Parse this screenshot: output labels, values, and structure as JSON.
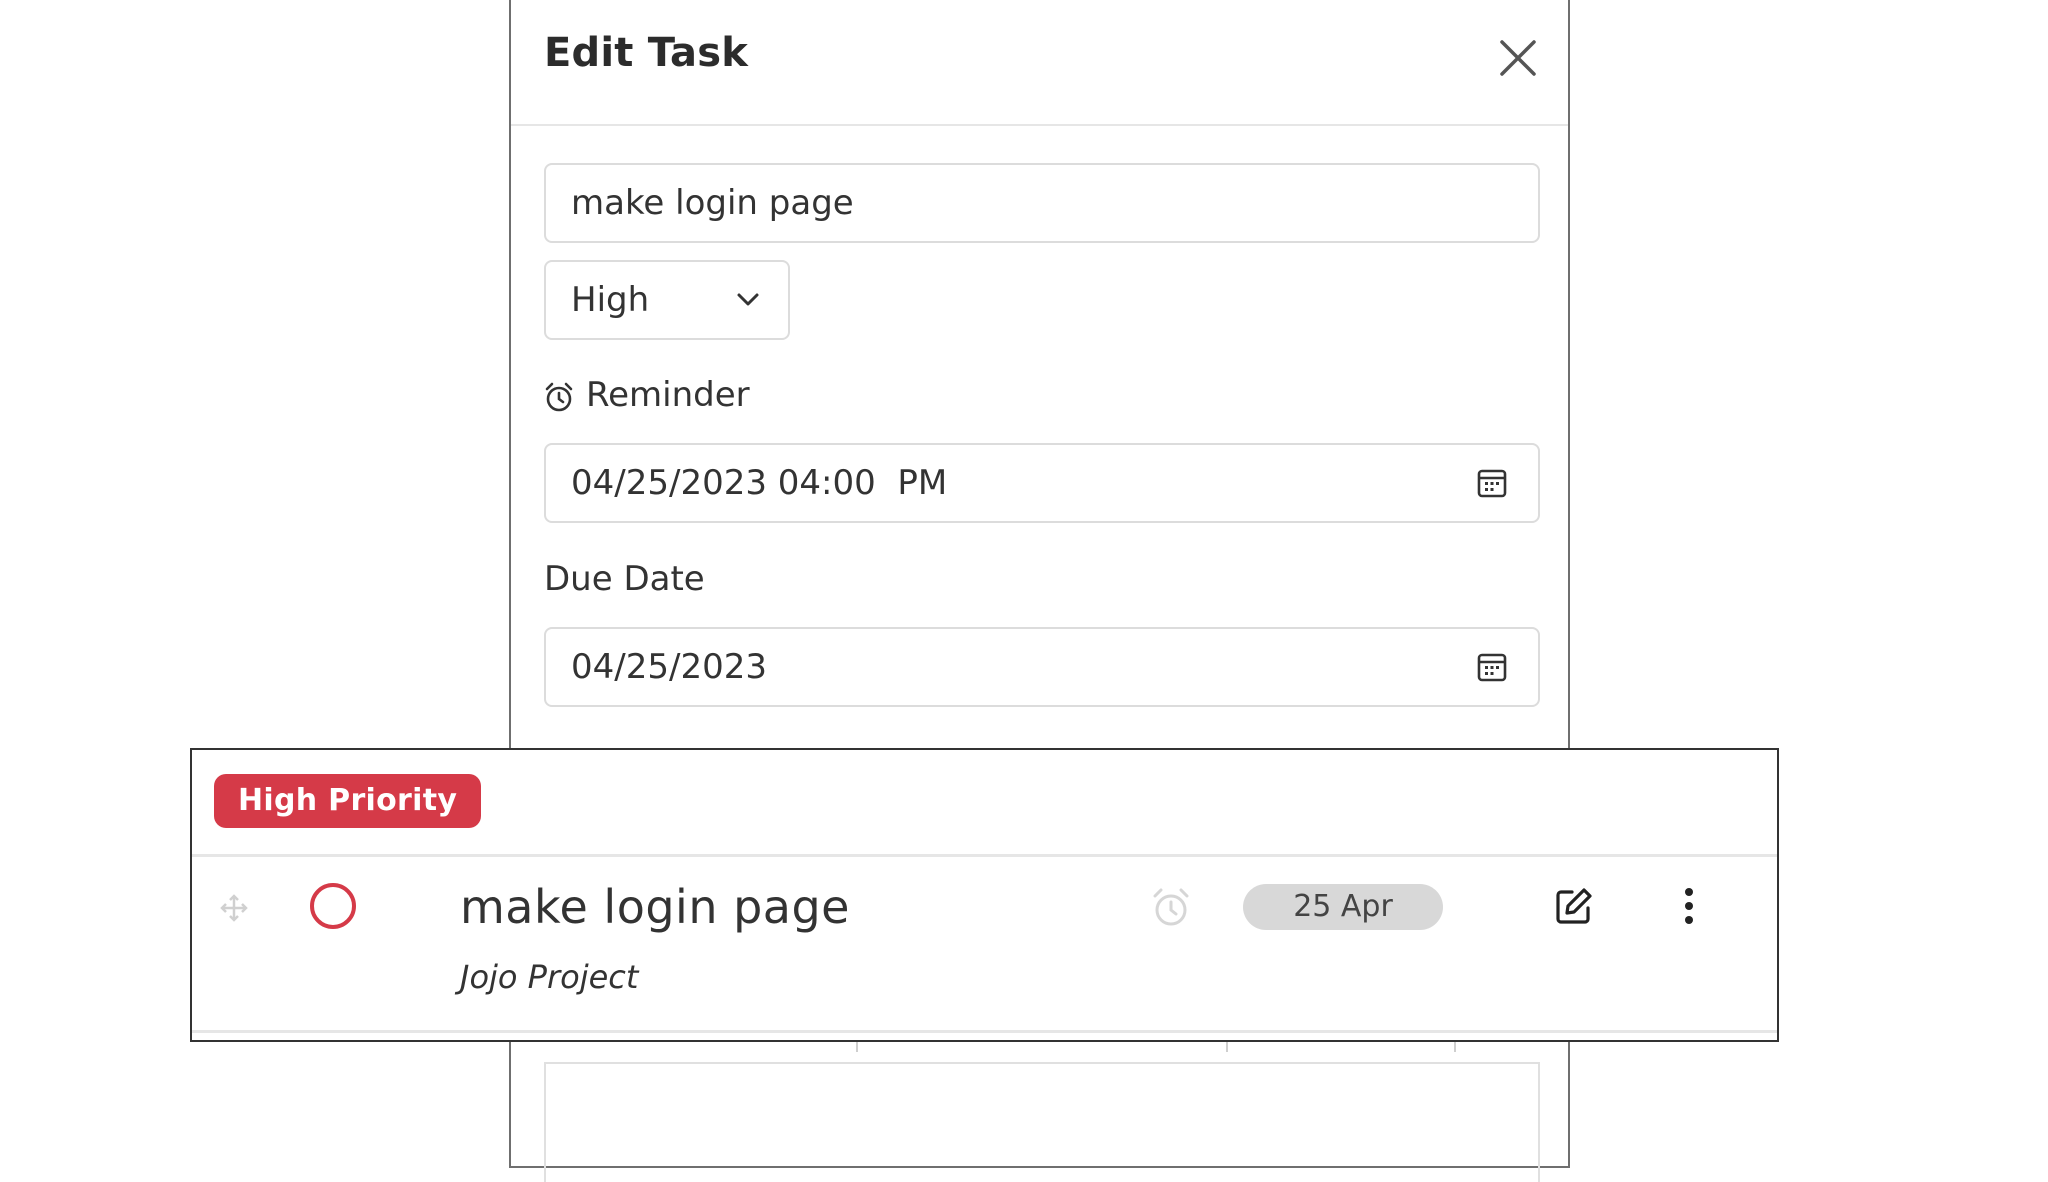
{
  "modal": {
    "title": "Edit Task",
    "close_icon": "close-icon",
    "task_name_value": "make login page",
    "priority_select": {
      "selected": "High",
      "icon": "chevron-down-icon"
    },
    "reminder": {
      "label": "Reminder",
      "icon": "alarm-clock-icon",
      "value": "04/25/2023 04:00  PM",
      "calendar_icon": "calendar-icon"
    },
    "due_date": {
      "label": "Due Date",
      "value": "04/25/2023",
      "calendar_icon": "calendar-icon"
    }
  },
  "task_card": {
    "priority_badge": "High Priority",
    "title": "make login page",
    "project": "Jojo Project",
    "date_chip": "25 Apr",
    "icons": [
      "drag-handle-icon",
      "complete-circle-icon",
      "alarm-clock-icon",
      "edit-icon",
      "more-vertical-icon"
    ]
  },
  "colors": {
    "priority_red": "#d53a48",
    "chip_gray": "#d8d8d8",
    "border_gray": "#dcdcdc"
  }
}
